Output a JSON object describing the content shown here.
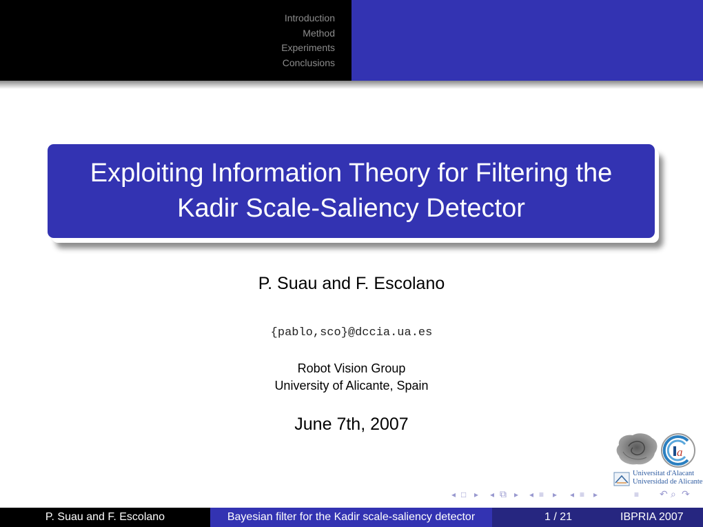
{
  "header": {
    "nav_items": [
      {
        "label": "Introduction"
      },
      {
        "label": "Method"
      },
      {
        "label": "Experiments"
      },
      {
        "label": "Conclusions"
      }
    ]
  },
  "title": {
    "line1": "Exploiting Information Theory for Filtering the",
    "line2": "Kadir Scale-Saliency Detector"
  },
  "authors": "P. Suau and F. Escolano",
  "email": "{pablo,sco}@dccia.ua.es",
  "institution": {
    "line1": "Robot Vision Group",
    "line2": "University of Alicante, Spain"
  },
  "date": "June 7th, 2007",
  "logos": {
    "ua_line1": "Universitat d'Alacant",
    "ua_line2": "Universidad de Alicante",
    "cia_text": "ia"
  },
  "nav_symbols": {
    "left": "◂",
    "right": "▸",
    "frame": "□",
    "subsection": "≡",
    "section": "≡",
    "search": "⌕",
    "back": "↶",
    "forward": "↷"
  },
  "footer": {
    "authors": "P. Suau and F. Escolano",
    "talk_title": "Bayesian filter for the Kadir scale-saliency detector",
    "page": "1 / 21",
    "conference": "IBPRIA 2007"
  },
  "colors": {
    "beamer_blue": "#3333b2",
    "beamer_dark_blue": "#262680",
    "nav_gray": "#8c8c8c"
  }
}
